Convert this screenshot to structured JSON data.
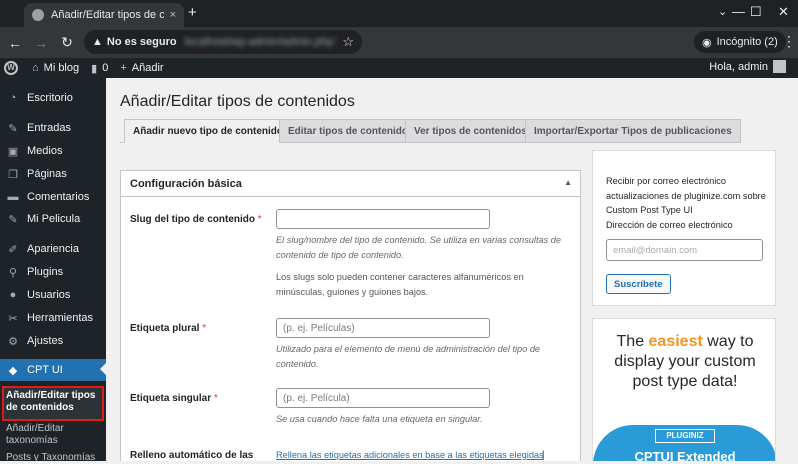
{
  "browser": {
    "tab_title": "Añadir/Editar tipos de contenido",
    "new_tab": "+",
    "tab_close": "×",
    "insecure_label": "No es seguro",
    "url": "localhost/wp-admin/admin.php?page=cptui_manage_post_types",
    "incognito_label": "Incógnito (2)"
  },
  "adminbar": {
    "site_name": "Mi blog",
    "comments_count": "0",
    "new_label": "Añadir",
    "greeting": "Hola, admin"
  },
  "sidebar": {
    "items": [
      {
        "label": "Escritorio",
        "icon": "dashboard-icon"
      },
      {
        "label": "Entradas",
        "icon": "pushpin-icon"
      },
      {
        "label": "Medios",
        "icon": "media-icon"
      },
      {
        "label": "Páginas",
        "icon": "pages-icon"
      },
      {
        "label": "Comentarios",
        "icon": "comments-icon"
      },
      {
        "label": "Mi Pelicula",
        "icon": "pushpin-icon"
      },
      {
        "label": "Apariencia",
        "icon": "brush-icon"
      },
      {
        "label": "Plugins",
        "icon": "plugin-icon"
      },
      {
        "label": "Usuarios",
        "icon": "users-icon"
      },
      {
        "label": "Herramientas",
        "icon": "wrench-icon"
      },
      {
        "label": "Ajustes",
        "icon": "settings-icon"
      },
      {
        "label": "CPT UI",
        "icon": "cptui-icon"
      }
    ],
    "submenu": [
      "Añadir/Editar tipos de contenidos",
      "Añadir/Editar taxonomías",
      "Posts y Taxonomías"
    ]
  },
  "page": {
    "title": "Añadir/Editar tipos de contenidos",
    "tabs": [
      "Añadir nuevo tipo de contenido",
      "Editar tipos de contenido",
      "Ver tipos de contenidos",
      "Importar/Exportar Tipos de publicaciones"
    ]
  },
  "panel": {
    "heading": "Configuración básica",
    "slug": {
      "label": "Slug del tipo de contenido",
      "required": "*",
      "value": "",
      "help": "El slug/nombre del tipo de contenido. Se utiliza en varias consultas de contenido de tipo de contenido.",
      "note": "Los slugs solo pueden contener caracteres alfanuméricos en minúsculas, guiones y guiones bajos."
    },
    "plural": {
      "label": "Etiqueta plural",
      "required": "*",
      "placeholder": "(p. ej. Películas)",
      "help": "Utilizado para el elemento de menú de administración del tipo de contenido."
    },
    "singular": {
      "label": "Etiqueta singular",
      "required": "*",
      "placeholder": "(p. ej. Película)",
      "help": "Se usa cuando hace falta una etiqueta en singular."
    },
    "autofill": {
      "label": "Relleno automático de las",
      "link": "Rellena las etiquetas adicionales en base a las etiquetas elegidas",
      "separator": "|"
    }
  },
  "subscribe": {
    "text": "Recibir por correo electrónico actualizaciones de pluginize.com sobre Custom Post Type UI",
    "email_label": "Dirección de correo electrónico",
    "email_placeholder": "email@domain.com",
    "button": "Suscríbete"
  },
  "promo": {
    "line1_pre": "The ",
    "line1_hl": "easiest",
    "line1_post": " way to",
    "line2": "display your custom",
    "line3": "post type data!",
    "logo": "PLUGINIZ",
    "extended": "CPTUI Extended"
  },
  "colors": {
    "admin_dark": "#1d2327",
    "accent": "#2271b1",
    "required": "#d63638",
    "highlight_box": "#e11a1a",
    "promo_orange": "#f7941d"
  }
}
